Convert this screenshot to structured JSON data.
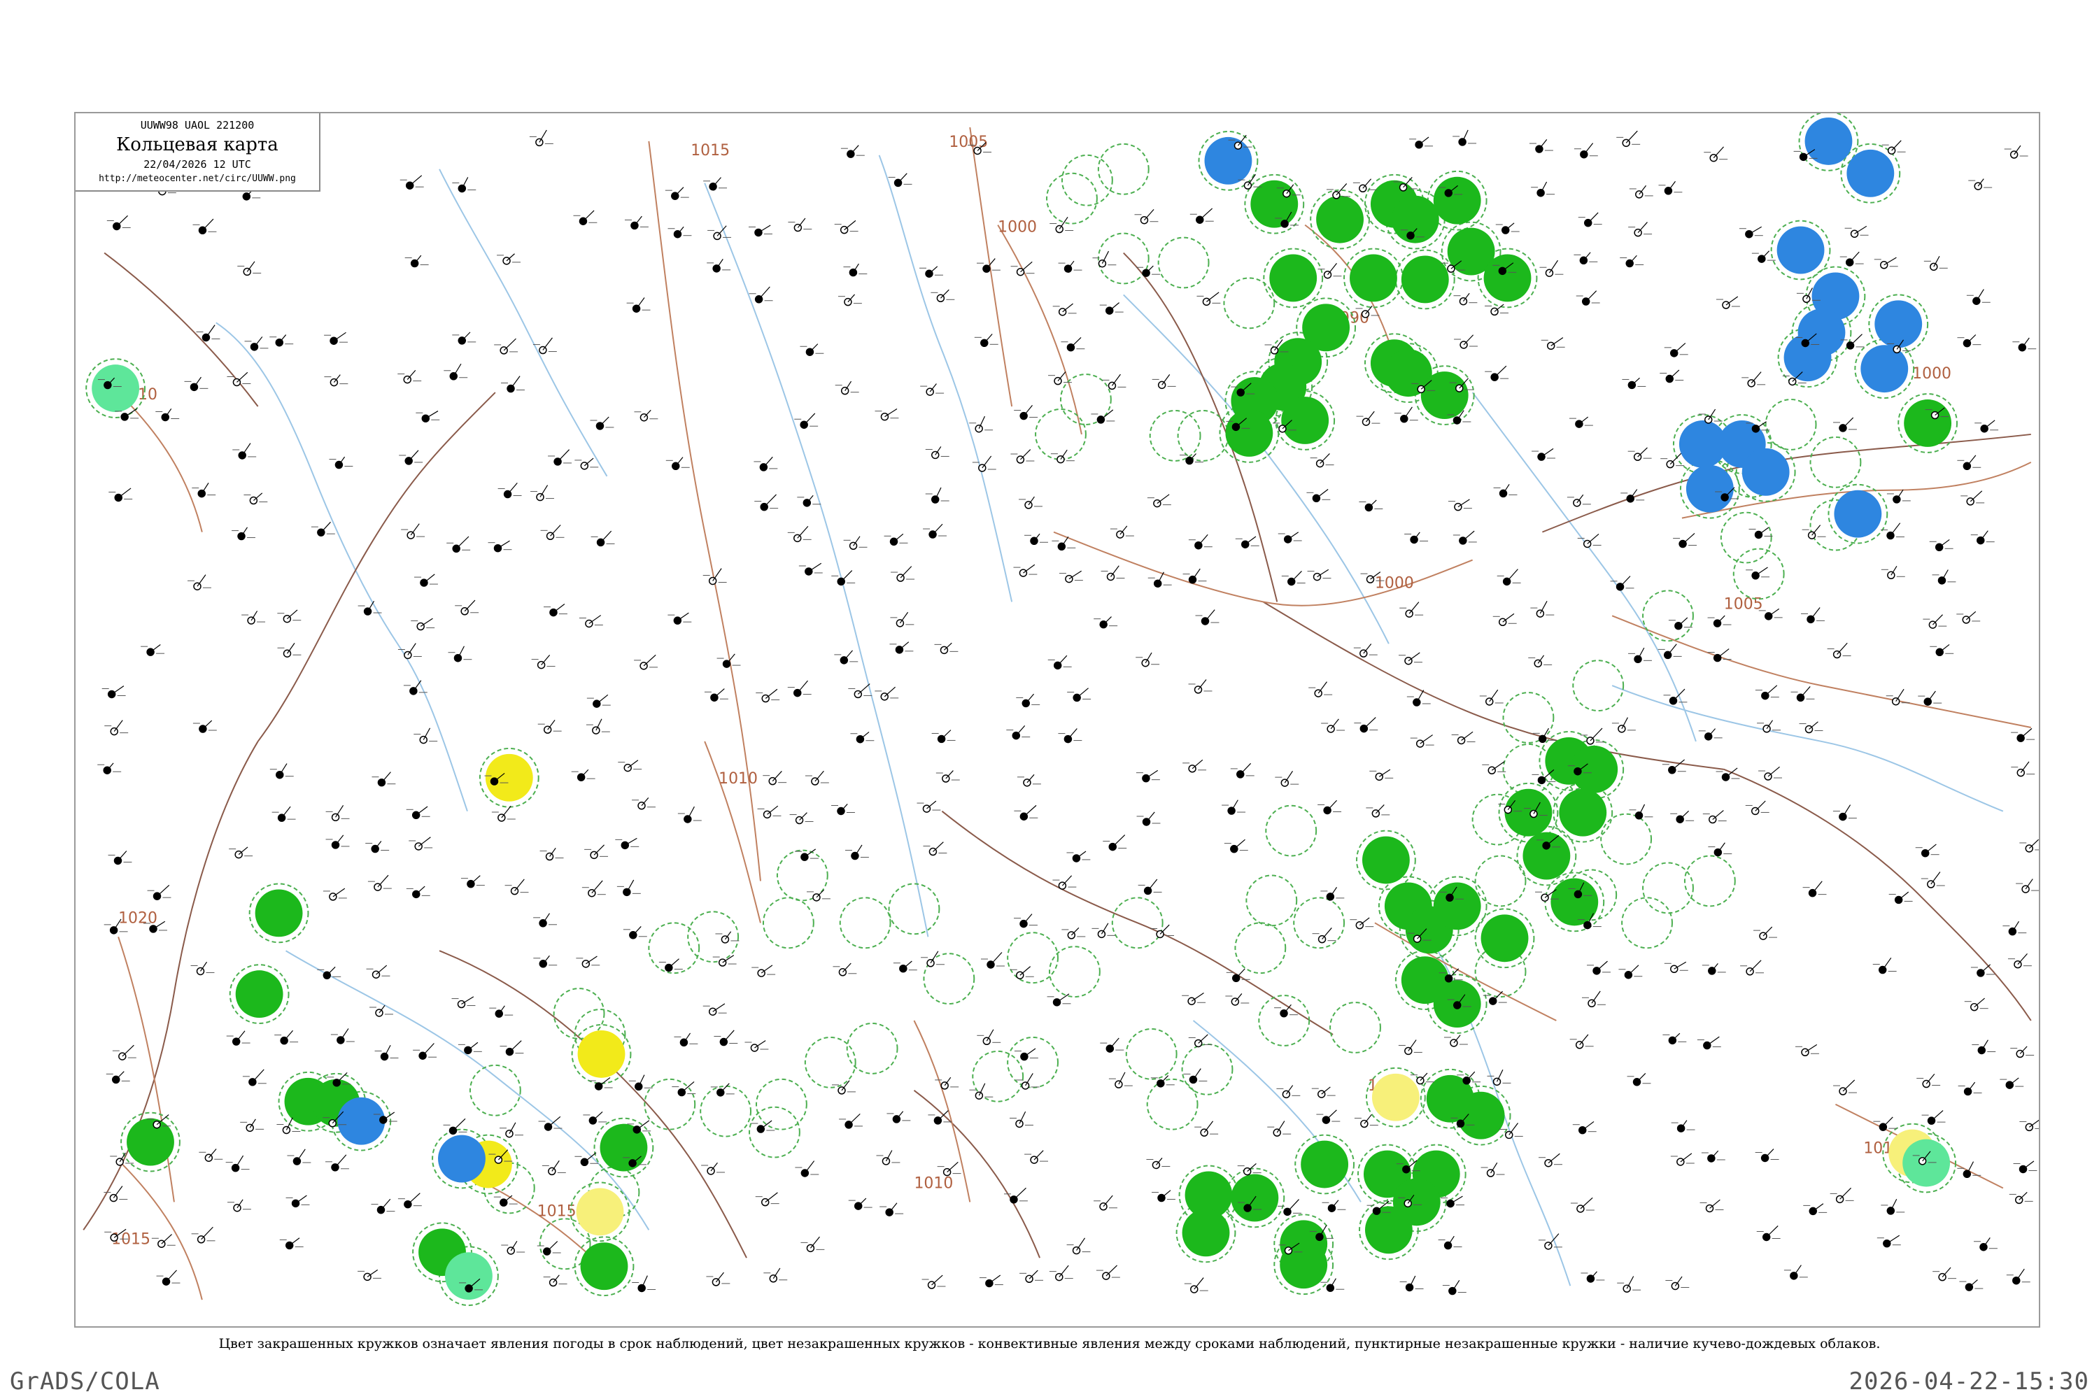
{
  "header": {
    "bulletin_code": "UUWW98  UAOL  221200",
    "title": "Кольцевая карта",
    "date": "22/04/2026 12 UTC",
    "url": "http://meteocenter.net/circ/UUWW.png"
  },
  "isobars": [
    {
      "label": "1015"
    },
    {
      "label": "1005"
    },
    {
      "label": "1000"
    },
    {
      "label": "990"
    },
    {
      "label": "1000"
    },
    {
      "label": "1000"
    },
    {
      "label": "1005"
    },
    {
      "label": "1010"
    },
    {
      "label": "1020"
    },
    {
      "label": "1015"
    },
    {
      "label": "1010"
    },
    {
      "label": "1010"
    },
    {
      "label": "1015"
    },
    {
      "label": "1010"
    },
    {
      "label": "1010"
    }
  ],
  "legend": {
    "caption": "Цвет закрашенных кружков означает явления погоды в срок наблюдений, цвет незакрашенных кружков - конвективные явления между сроками наблюдений, пунктирные незакрашенные кружки - наличие кучево-дождевых облаков."
  },
  "colors": {
    "rain": "#1cb81c",
    "snow": "#2e86e0",
    "fog": "#f2ea1a",
    "haze": "#f7f07a",
    "drizzle": "#5ee69a",
    "cb_dashed": "#4caf50",
    "isobar": "#b06040",
    "river": "#8fbfe0",
    "border": "#8a5a4a"
  },
  "footer": {
    "left": "GrADS/COLA",
    "right": "2026-04-22-15:30"
  }
}
